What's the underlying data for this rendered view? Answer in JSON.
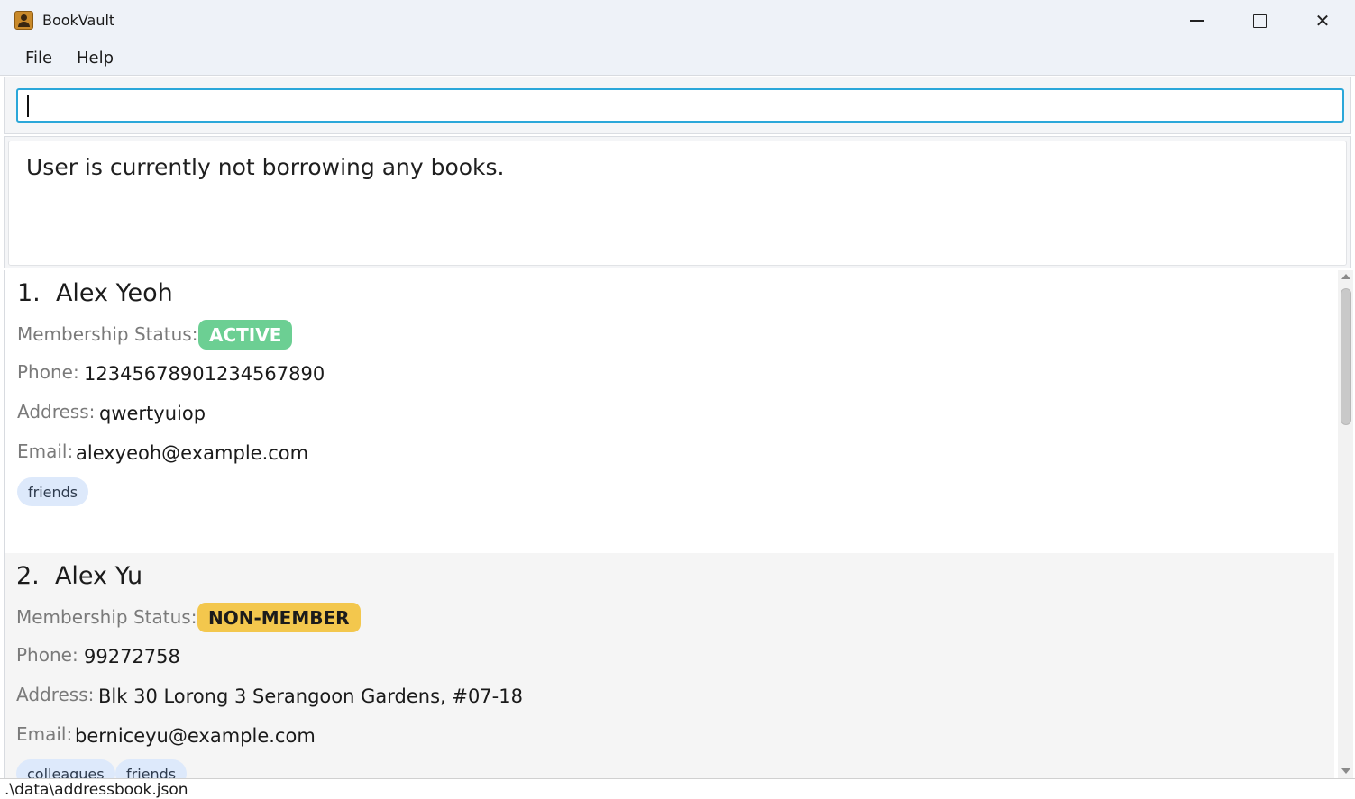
{
  "window": {
    "title": "BookVault",
    "minimize_icon": "minimize-icon",
    "maximize_icon": "maximize-icon",
    "close_icon": "close-icon",
    "close_glyph": "✕"
  },
  "menu": {
    "file": "File",
    "help": "Help"
  },
  "command": {
    "value": "",
    "placeholder": ""
  },
  "result": {
    "message": "User is currently not borrowing any books."
  },
  "persons": [
    {
      "index": "1.",
      "name": "Alex Yeoh",
      "membership_label": "Membership Status:",
      "membership_status": "ACTIVE",
      "membership_color": "#6ccf93",
      "phone_label": "Phone:",
      "phone": "12345678901234567890",
      "address_label": "Address:",
      "address": "qwertyuiop",
      "email_label": "Email:",
      "email": "alexyeoh@example.com",
      "tags": [
        "friends"
      ]
    },
    {
      "index": "2.",
      "name": "Alex Yu",
      "membership_label": "Membership Status:",
      "membership_status": "NON-MEMBER",
      "membership_color": "#f3c74d",
      "phone_label": "Phone:",
      "phone": "99272758",
      "address_label": "Address:",
      "address": "Blk 30 Lorong 3 Serangoon Gardens, #07-18",
      "email_label": "Email:",
      "email": "berniceyu@example.com",
      "tags": [
        "colleagues",
        "friends"
      ]
    }
  ],
  "status_bar": {
    "file_path": ".\\data\\addressbook.json"
  }
}
